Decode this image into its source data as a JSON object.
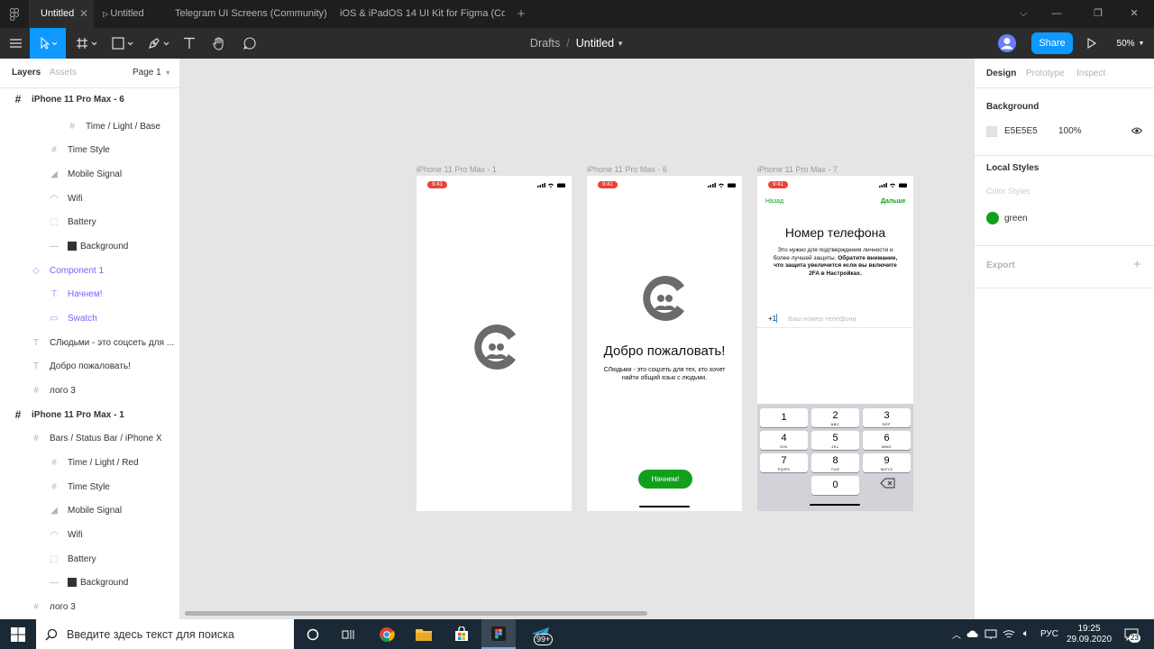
{
  "tabs": [
    {
      "label": "Untitled",
      "active": true
    },
    {
      "label": "Untitled",
      "active": false
    },
    {
      "label": "Telegram UI Screens (Community)",
      "active": false
    },
    {
      "label": "iOS & iPadOS 14 UI Kit for Figma (Co...",
      "active": false
    }
  ],
  "header": {
    "breadcrumb_root": "Drafts",
    "breadcrumb_sep": "/",
    "file_name": "Untitled",
    "share_label": "Share",
    "zoom": "50%"
  },
  "left_panel": {
    "tab_layers": "Layers",
    "tab_assets": "Assets",
    "page": "Page 1",
    "layers": [
      {
        "label": "iPhone 11 Pro Max - 6",
        "indent": 0,
        "icon": "#",
        "bold": true
      },
      {
        "label": "Time / Light / Base",
        "indent": 3,
        "icon": "#"
      },
      {
        "label": "Time Style",
        "indent": 2,
        "icon": "#"
      },
      {
        "label": "Mobile Signal",
        "indent": 2,
        "icon": "◢"
      },
      {
        "label": "Wifi",
        "indent": 2,
        "icon": "◠"
      },
      {
        "label": "Battery",
        "indent": 2,
        "icon": "⬚"
      },
      {
        "label": "Background",
        "indent": 2,
        "icon": "—",
        "swatch": true
      },
      {
        "label": "Component 1",
        "indent": 1,
        "icon": "◇",
        "purple": true
      },
      {
        "label": "Начнем!",
        "indent": 2,
        "icon": "T",
        "purple": true
      },
      {
        "label": "Swatch",
        "indent": 2,
        "icon": "▭",
        "purple": true
      },
      {
        "label": "СЛюдьми - это соцсеть для ...",
        "indent": 1,
        "icon": "T"
      },
      {
        "label": "Добро пожаловать!",
        "indent": 1,
        "icon": "T"
      },
      {
        "label": "лого 3",
        "indent": 1,
        "icon": "#"
      },
      {
        "label": "iPhone 11 Pro Max - 1",
        "indent": 0,
        "icon": "#",
        "bold": true
      },
      {
        "label": "Bars / Status Bar / iPhone X",
        "indent": 1,
        "icon": "#"
      },
      {
        "label": "Time / Light / Red",
        "indent": 2,
        "icon": "#"
      },
      {
        "label": "Time Style",
        "indent": 2,
        "icon": "#"
      },
      {
        "label": "Mobile Signal",
        "indent": 2,
        "icon": "◢"
      },
      {
        "label": "Wifi",
        "indent": 2,
        "icon": "◠"
      },
      {
        "label": "Battery",
        "indent": 2,
        "icon": "⬚"
      },
      {
        "label": "Background",
        "indent": 2,
        "icon": "—",
        "swatch": true
      },
      {
        "label": "лого 3",
        "indent": 1,
        "icon": "#"
      }
    ]
  },
  "right_panel": {
    "tab_design": "Design",
    "tab_prototype": "Prototype",
    "tab_inspect": "Inspect",
    "background_title": "Background",
    "background_hex": "E5E5E5",
    "background_opacity": "100%",
    "local_styles_title": "Local Styles",
    "color_styles_label": "Color Styles",
    "style_name": "green",
    "style_color": "#12a01c",
    "export_title": "Export"
  },
  "frames": [
    {
      "label": "iPhone 11 Pro Max - 1",
      "time": "9:41"
    },
    {
      "label": "iPhone 11 Pro Max - 6",
      "time": "9:41",
      "title": "Добро пожаловать!",
      "subtitle_line1": "СЛюдьми - это соцсеть для тех, кто хочет",
      "subtitle_line2": "найти общий язык с людьми.",
      "button": "Начнем!"
    },
    {
      "label": "iPhone 11 Pro Max - 7",
      "time": "9:41",
      "back": "Назад",
      "next": "Дальше",
      "title": "Номер телефона",
      "desc_line1": "Это нужно для подтверждения личности и",
      "desc_line2": "более лучшей защиты.",
      "desc_bold2": "Обратите внимание,",
      "desc_line3": "что защита увеличится если вы включите",
      "desc_line4": "2FA в Настройках.",
      "country_code": "+1",
      "phone_placeholder": "Ваш номер телефона",
      "keys": [
        {
          "n": "1",
          "s": ""
        },
        {
          "n": "2",
          "s": "ABC"
        },
        {
          "n": "3",
          "s": "DEF"
        },
        {
          "n": "4",
          "s": "GHI"
        },
        {
          "n": "5",
          "s": "JKL"
        },
        {
          "n": "6",
          "s": "MNO"
        },
        {
          "n": "7",
          "s": "PQRS"
        },
        {
          "n": "8",
          "s": "TUV"
        },
        {
          "n": "9",
          "s": "WXYZ"
        },
        {
          "n": "0",
          "s": ""
        }
      ]
    }
  ],
  "colors": {
    "accent": "#0d99ff",
    "green": "#12a01c",
    "logo_gray": "#6b6b6b",
    "pill_red": "#ea4335"
  },
  "help_label": "?",
  "taskbar": {
    "search_placeholder": "Введите здесь текст для поиска",
    "badge_telegram": "99+",
    "lang": "РУС",
    "time": "19:25",
    "date": "29.09.2020",
    "notif_count": "23"
  }
}
